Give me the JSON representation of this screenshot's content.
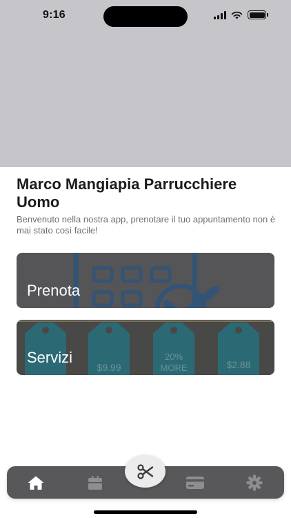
{
  "status_bar": {
    "time": "9:16"
  },
  "header": {
    "title": "Marco Mangiapia Parrucchiere Uomo",
    "subtitle": "Benvenuto nella nostra app, prenotare il tuo appuntamento non è mai stato così facile!"
  },
  "cards": {
    "prenota": {
      "label": "Prenota"
    },
    "servizi": {
      "label": "Servizi",
      "tags": [
        "$9.99",
        "20%",
        "MORE",
        "$2.88"
      ]
    }
  },
  "tab_bar": {
    "items": [
      {
        "icon": "home-icon",
        "active": true
      },
      {
        "icon": "calendar-icon",
        "active": false
      },
      {
        "icon": "scissors-icon",
        "active": false
      },
      {
        "icon": "credit-card-icon",
        "active": false
      },
      {
        "icon": "gear-icon",
        "active": false
      }
    ]
  },
  "colors": {
    "hero": "#c6c6ca",
    "tab_bar": "#58585a",
    "tab_active": "#ffffff",
    "tab_inactive": "#8e8e90",
    "calendar_blue": "#2a5d8f",
    "tag_teal": "#1e7f90"
  }
}
